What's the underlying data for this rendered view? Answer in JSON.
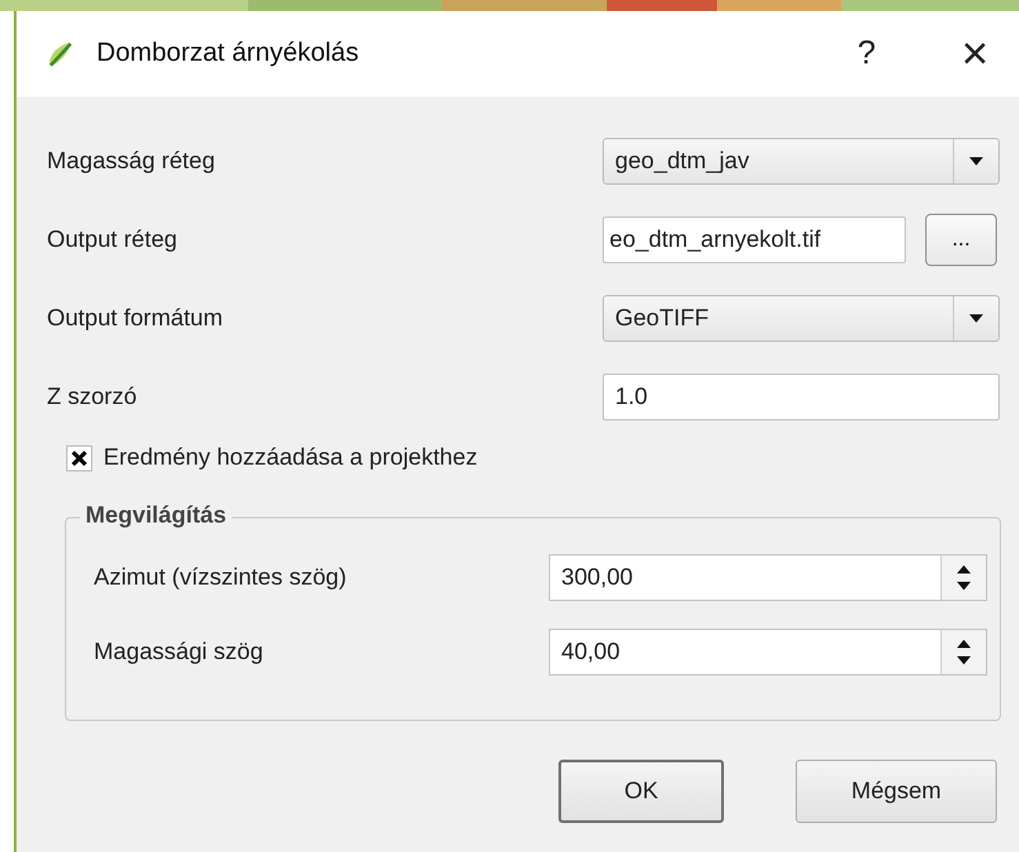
{
  "window": {
    "title": "Domborzat árnyékolás",
    "help": "?",
    "close": "×"
  },
  "rows": [
    {
      "kind": "combo",
      "label": "Magasság réteg",
      "value": "geo_dtm_jav"
    },
    {
      "kind": "file",
      "label": "Output réteg",
      "value": "eo_dtm_arnyekolt.tif",
      "browse": "..."
    },
    {
      "kind": "combo",
      "label": "Output formátum",
      "value": "GeoTIFF"
    },
    {
      "kind": "text",
      "label": "Z szorzó",
      "value": "1.0"
    }
  ],
  "add_to_project": {
    "label": "Eredmény hozzáadása a projekthez",
    "checked": true
  },
  "group": {
    "title": "Megvilágítás",
    "rows": [
      {
        "label": "Azimut (vízszintes szög)",
        "value": "300,00"
      },
      {
        "label": "Magassági szög",
        "value": "40,00"
      }
    ]
  },
  "buttons": [
    {
      "label": "OK",
      "default": true
    },
    {
      "label": "Mégsem",
      "default": false
    }
  ]
}
